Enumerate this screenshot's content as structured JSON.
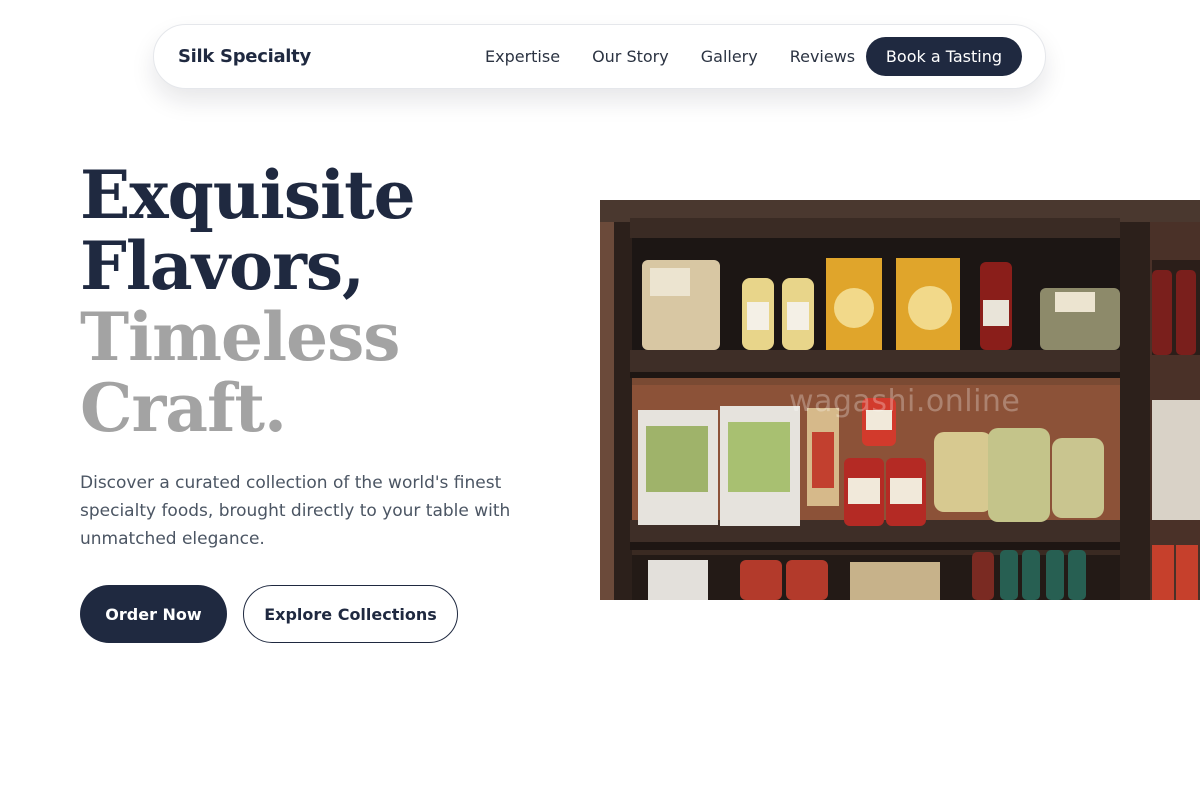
{
  "brand": {
    "name": "Silk Specialty"
  },
  "nav": {
    "links": [
      "Expertise",
      "Our Story",
      "Gallery",
      "Reviews"
    ],
    "cta": "Book a Tasting"
  },
  "hero": {
    "headline_dark": [
      "Exquisite",
      "Flavors,"
    ],
    "headline_light": [
      "Timeless",
      "Craft."
    ],
    "lead": "Discover a curated collection of the world's finest specialty foods, brought directly to your table with unmatched elegance.",
    "primary_button": "Order Now",
    "secondary_button": "Explore Collections",
    "image_watermark": "wagashi.online"
  },
  "colors": {
    "primary": "#1f2940",
    "muted_heading": "#a3a3a3",
    "body_text": "#4b5563"
  }
}
